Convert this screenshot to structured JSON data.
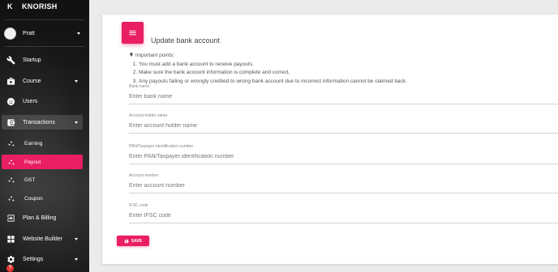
{
  "brand": {
    "logo_letter": "K",
    "name": "KNORISH"
  },
  "user": {
    "name": "Pratt"
  },
  "sidebar": {
    "items": [
      {
        "label": "Startup",
        "icon": "wrench-icon"
      },
      {
        "label": "Course",
        "icon": "briefcase-icon"
      },
      {
        "label": "Users",
        "icon": "user-face-icon"
      },
      {
        "label": "Transactions",
        "icon": "wallet-icon"
      },
      {
        "label": "Earning",
        "icon": "chart-dots-icon"
      },
      {
        "label": "Payout",
        "icon": "chart-dots-icon"
      },
      {
        "label": "GST",
        "icon": "chart-dots-icon"
      },
      {
        "label": "Coupon",
        "icon": "chart-dots-icon"
      },
      {
        "label": "Plan & Billing",
        "icon": "login-icon"
      },
      {
        "label": "Website Builder",
        "icon": "grid-icon"
      },
      {
        "label": "Settings",
        "icon": "gear-icon"
      }
    ],
    "help_label": "?"
  },
  "card": {
    "title": "Update bank account",
    "important_heading": "Important points:",
    "points": [
      "You must add a bank account to receive payouts.",
      "Make sure the bank account information is complete and correct.",
      "Any payouts failing or wrongly credited to wrong bank account due to incorrect information cannot be claimed back."
    ]
  },
  "form": {
    "bank_name": {
      "label": "Bank name",
      "placeholder": "Enter bank name"
    },
    "holder_name": {
      "label": "Account holder name",
      "placeholder": "Enter account holder name"
    },
    "pan": {
      "label": "PAN/Taxpayer identification number",
      "placeholder": "Enter PAN/Taxpayer identification number"
    },
    "account_number": {
      "label": "Account number",
      "placeholder": "Enter account number"
    },
    "ifsc": {
      "label": "IFSC code",
      "placeholder": "Enter IFSC code"
    },
    "save_label": "SAVE"
  },
  "colors": {
    "accent": "#e91e63",
    "sidebar_bg": "#1a1a1a",
    "page_bg": "#ebebeb"
  }
}
